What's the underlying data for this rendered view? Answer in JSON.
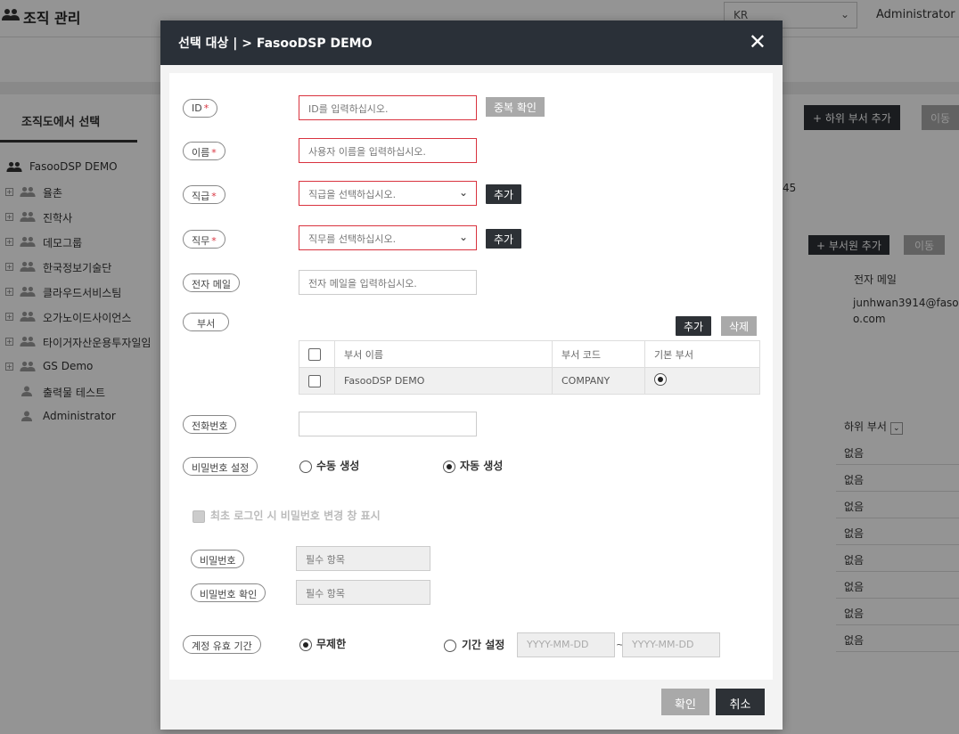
{
  "page": {
    "title": "조직 관리",
    "language": "KR",
    "user": "Administrator (a"
  },
  "sidebar": {
    "tab": "조직도에서 선택",
    "root": "FasooDSP DEMO",
    "items": [
      {
        "label": "율촌"
      },
      {
        "label": "진학사"
      },
      {
        "label": "데모그룹"
      },
      {
        "label": "한국정보기술단"
      },
      {
        "label": "클라우드서비스팀"
      },
      {
        "label": "오가노이드사이언스"
      },
      {
        "label": "타이거자산운용투자일임"
      },
      {
        "label": "GS Demo"
      }
    ],
    "users": [
      {
        "label": "출력물 테스트"
      },
      {
        "label": "Administrator"
      }
    ]
  },
  "background": {
    "add_sub_dept": "+ 하위 부서 추가",
    "move": "이동",
    "add_member": "+ 부서원 추가",
    "move2": "이동",
    "partial_number": "45",
    "col_email": "전자 메일",
    "email_value": "junhwan3914@faso o.com",
    "col_sub_dept": "하위 부서",
    "none_values": [
      "없음",
      "없음",
      "없음",
      "없음",
      "없음",
      "없음",
      "없음",
      "없음"
    ]
  },
  "modal": {
    "title": "선택 대상 |  > FasooDSP DEMO",
    "close": "✕",
    "fields": {
      "id": {
        "label": "ID",
        "required": "*",
        "placeholder": "ID를 입력하십시오.",
        "button": "중복 확인"
      },
      "name": {
        "label": "이름",
        "required": "*",
        "placeholder": "사용자 이름을 입력하십시오."
      },
      "rank": {
        "label": "직급",
        "required": "*",
        "placeholder": "직급을 선택하십시오.",
        "button": "추가"
      },
      "duty": {
        "label": "직무",
        "required": "*",
        "placeholder": "직무를 선택하십시오.",
        "button": "추가"
      },
      "email": {
        "label": "전자 메일",
        "placeholder": "전자 메일을 입력하십시오."
      },
      "dept": {
        "label": "부서",
        "add": "추가",
        "delete": "삭제",
        "columns": [
          "부서 이름",
          "부서 코드",
          "기본 부서"
        ],
        "rows": [
          {
            "name": "FasooDSP DEMO",
            "code": "COMPANY"
          }
        ]
      },
      "phone": {
        "label": "전화번호",
        "value": ""
      },
      "password_setting": {
        "label": "비밀번호 설정",
        "manual": "수동 생성",
        "auto": "자동 생성"
      },
      "first_login": {
        "label": "최초 로그인 시 비밀번호 변경 창 표시"
      },
      "password": {
        "label": "비밀번호",
        "placeholder": "필수 항목"
      },
      "password_confirm": {
        "label": "비밀번호 확인",
        "placeholder": "필수 항목"
      },
      "validity": {
        "label": "계정 유효 기간",
        "unlimited": "무제한",
        "period": "기간 설정",
        "start": "YYYY-MM-DD",
        "tilde": "~",
        "end": "YYYY-MM-DD"
      }
    },
    "confirm": "확인",
    "cancel": "취소"
  }
}
